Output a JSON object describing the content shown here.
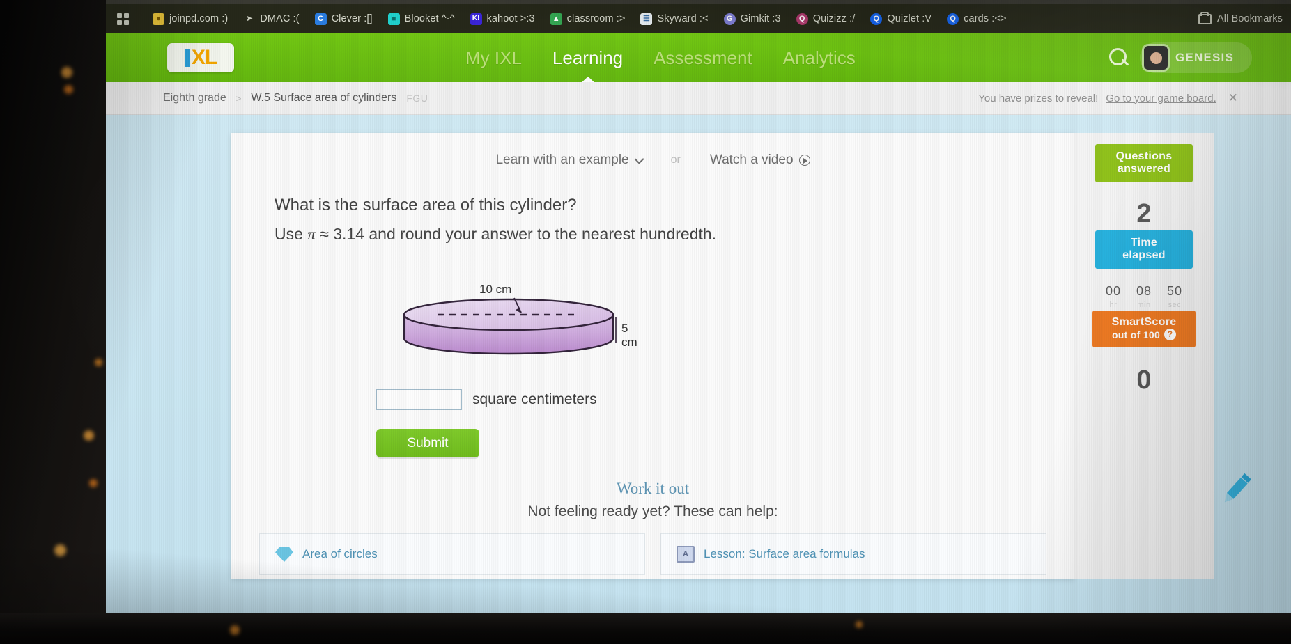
{
  "browser": {
    "apps_icon": "apps-grid-icon",
    "bookmarks": [
      {
        "label": "joinpd.com :)",
        "icon": "lightbulb-icon",
        "icon_glyph": "●",
        "color": "#e8c33a",
        "text_color": "#7a5a00"
      },
      {
        "label": "DMAC :(",
        "icon": "bird-icon",
        "icon_glyph": "✈",
        "color": "#2b2d1e",
        "text_color": "#d7d9cb"
      },
      {
        "label": "Clever :[]",
        "icon": "clever-c-icon",
        "icon_glyph": "C",
        "color": "#2a7de1",
        "text_color": "#ffffff"
      },
      {
        "label": "Blooket ^-^",
        "icon": "blooket-icon",
        "icon_glyph": "■",
        "color": "#20d1cd",
        "text_color": "#0b6f6d"
      },
      {
        "label": "kahoot >:3",
        "icon": "kahoot-k-icon",
        "icon_glyph": "K!",
        "color": "#3a25d8",
        "text_color": "#ffffff"
      },
      {
        "label": "classroom :>",
        "icon": "classroom-icon",
        "icon_glyph": "▲",
        "color": "#34a853",
        "text_color": "#ffffff"
      },
      {
        "label": "Skyward :<",
        "icon": "skyward-icon",
        "icon_glyph": "≡",
        "color": "#e8eef2",
        "text_color": "#3a6ea5"
      },
      {
        "label": "Gimkit :3",
        "icon": "gimkit-icon",
        "icon_glyph": "G",
        "color": "#7f7fd5",
        "text_color": "#ffffff"
      },
      {
        "label": "Quizizz :/",
        "icon": "quizizz-icon",
        "icon_glyph": "Q",
        "color": "#b03a6e",
        "text_color": "#ffffff"
      },
      {
        "label": "Quizlet :V",
        "icon": "quizlet-icon",
        "icon_glyph": "Q",
        "color": "#1565f0",
        "text_color": "#ffffff"
      },
      {
        "label": "cards :<>",
        "icon": "cards-icon",
        "icon_glyph": "Q",
        "color": "#1565f0",
        "text_color": "#ffffff"
      }
    ],
    "all_bookmarks_label": "All Bookmarks",
    "all_bookmarks_icon": "folder-icon"
  },
  "nav": {
    "logo_text": "XL",
    "tabs": [
      {
        "label": "My IXL",
        "state": "dim"
      },
      {
        "label": "Learning",
        "state": "active"
      },
      {
        "label": "Assessment",
        "state": "dim"
      },
      {
        "label": "Analytics",
        "state": "dim"
      }
    ],
    "search_icon": "search-icon",
    "username": "GENESIS",
    "avatar_icon": "avatar-icon"
  },
  "breadcrumb": {
    "grade": "Eighth grade",
    "separator": ">",
    "skill": "W.5 Surface area of cylinders",
    "skill_code": "FGU"
  },
  "prize_banner": {
    "trophy_icon": "trophy-icon",
    "text": "You have prizes to reveal!",
    "link": "Go to your game board.",
    "close_icon": "✕"
  },
  "question": {
    "learn_label": "Learn with an example",
    "learn_chevron_icon": "chevron-down-icon",
    "or_label": "or",
    "video_label": "Watch a video",
    "video_icon": "play-circle-icon",
    "title": "What is the surface area of this cylinder?",
    "instruction_prefix": "Use ",
    "instruction_pi": "π",
    "instruction_suffix": " ≈ 3.14 and round your answer to the nearest hundredth.",
    "answer_value": "",
    "answer_placeholder": "",
    "answer_unit": "square centimeters",
    "submit_label": "Submit",
    "pencil_icon": "pencil-icon"
  },
  "figure": {
    "name": "cylinder-diagram",
    "diameter_label": "10 cm",
    "height_label": "5 cm",
    "body_color": "#c9a0d8",
    "outline_color": "#2b1b33"
  },
  "work_it_out": {
    "heading": "Work it out",
    "subheading": "Not feeling ready yet? These can help:",
    "cards": [
      {
        "label": "Area of circles",
        "icon": "gem-icon"
      },
      {
        "label": "Lesson: Surface area formulas",
        "icon": "lesson-book-icon"
      }
    ]
  },
  "side_panel": {
    "questions": {
      "badge": "Questions\nanswered",
      "badge_line1": "Questions",
      "badge_line2": "answered",
      "value": "2",
      "color": "#8cc013"
    },
    "time": {
      "badge_line1": "Time",
      "badge_line2": "elapsed",
      "color": "#24b0dd",
      "hours": "00",
      "minutes": "08",
      "seconds": "50",
      "cap_hours": "hr",
      "cap_minutes": "min",
      "cap_seconds": "sec"
    },
    "smartscore": {
      "badge_line1": "SmartScore",
      "badge_line2": "out of 100",
      "help_icon": "?",
      "value": "0",
      "color": "#ee7a23"
    }
  },
  "colors": {
    "ixl_green": "#6ebb1a",
    "page_blue": "#cfe9f3",
    "bookmark_bar": "#26281a"
  }
}
